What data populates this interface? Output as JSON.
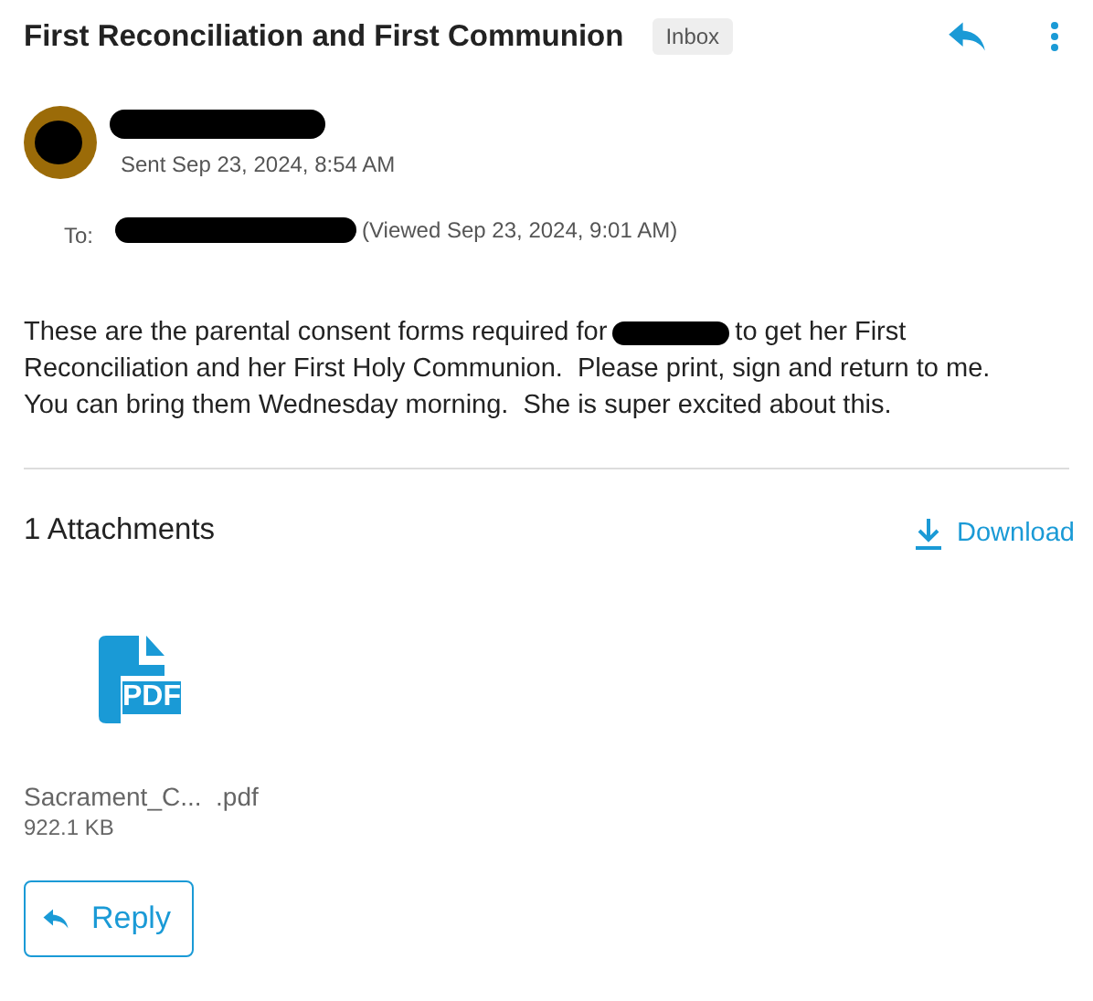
{
  "header": {
    "subject": "First Reconciliation and First Communion",
    "folder_badge": "Inbox"
  },
  "sender": {
    "sent_time": "Sent Sep 23, 2024, 8:54 AM"
  },
  "recipients": {
    "label": "To:",
    "viewed": "(Viewed Sep 23, 2024, 9:01 AM)"
  },
  "body": {
    "line_1_before": "These are the parental consent forms required for",
    "line_1_after": "to get her First",
    "lines": [
      "Reconciliation and her First Holy Communion.  Please print, sign and return to me.",
      "You can bring them Wednesday morning.  She is super excited about this."
    ]
  },
  "attachments": {
    "count_label": "1 Attachments",
    "download": "Download",
    "files": [
      {
        "type_label": "PDF",
        "name": "Sacrament_C...  .pdf",
        "size": "922.1 KB"
      }
    ]
  },
  "reply_button": "Reply"
}
